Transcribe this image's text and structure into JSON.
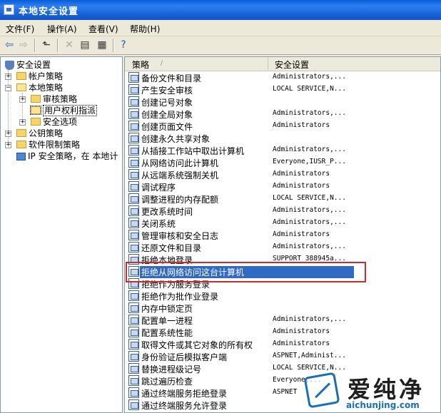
{
  "window": {
    "title": "本地安全设置"
  },
  "menu": [
    "文件(F)",
    "操作(A)",
    "查看(V)",
    "帮助(H)"
  ],
  "toolbar_icons": [
    "back-arrow-icon",
    "forward-arrow-icon",
    "up-folder-icon",
    "delete-icon",
    "properties-icon",
    "export-list-icon",
    "help-icon"
  ],
  "tree": {
    "root": "安全设置",
    "account": "帐户策略",
    "local": "本地策略",
    "audit": "审核策略",
    "rights": "用户权利指派",
    "options": "安全选项",
    "pubkey": "公钥策略",
    "software": "软件限制策略",
    "ipsec": "IP 安全策略，在 本地计"
  },
  "list": {
    "col_policy": "策略",
    "col_setting": "安全设置",
    "rows": [
      {
        "name": "备份文件和目录",
        "value": "Administrators,..."
      },
      {
        "name": "产生安全审核",
        "value": "LOCAL SERVICE,N..."
      },
      {
        "name": "创建记号对象",
        "value": ""
      },
      {
        "name": "创建全局对象",
        "value": "Administrators,..."
      },
      {
        "name": "创建页面文件",
        "value": "Administrators"
      },
      {
        "name": "创建永久共享对象",
        "value": ""
      },
      {
        "name": "从插接工作站中取出计算机",
        "value": "Administrators,..."
      },
      {
        "name": "从网络访问此计算机",
        "value": "Everyone,IUSR_P..."
      },
      {
        "name": "从远端系统强制关机",
        "value": "Administrators"
      },
      {
        "name": "调试程序",
        "value": "Administrators"
      },
      {
        "name": "调整进程的内存配额",
        "value": "LOCAL SERVICE,N..."
      },
      {
        "name": "更改系统时间",
        "value": "Administrators,..."
      },
      {
        "name": "关闭系统",
        "value": "Administrators,..."
      },
      {
        "name": "管理审核和安全日志",
        "value": "Administrators"
      },
      {
        "name": "还原文件和目录",
        "value": "Administrators,..."
      },
      {
        "name": "拒绝本地登录",
        "value": "SUPPORT_388945a..."
      },
      {
        "name": "拒绝从网络访问这台计算机",
        "value": ""
      },
      {
        "name": "拒绝作为服务登录",
        "value": ""
      },
      {
        "name": "拒绝作为批作业登录",
        "value": ""
      },
      {
        "name": "内存中锁定页",
        "value": ""
      },
      {
        "name": "配置单一进程",
        "value": "Administrators,..."
      },
      {
        "name": "配置系统性能",
        "value": "Administrators"
      },
      {
        "name": "取得文件或其它对象的所有权",
        "value": "Administrators"
      },
      {
        "name": "身份验证后模拟客户端",
        "value": "ASPNET,Administ..."
      },
      {
        "name": "替换进程级记号",
        "value": "LOCAL SERVICE,N..."
      },
      {
        "name": "跳过遍历检查",
        "value": "Everyone,..."
      },
      {
        "name": "通过终端服务拒绝登录",
        "value": "ASPNET"
      },
      {
        "name": "通过终端服务允许登录",
        "value": ""
      }
    ],
    "selected_index": 16
  },
  "watermark": {
    "title": "爱纯净",
    "url": "aichunjing.com"
  }
}
